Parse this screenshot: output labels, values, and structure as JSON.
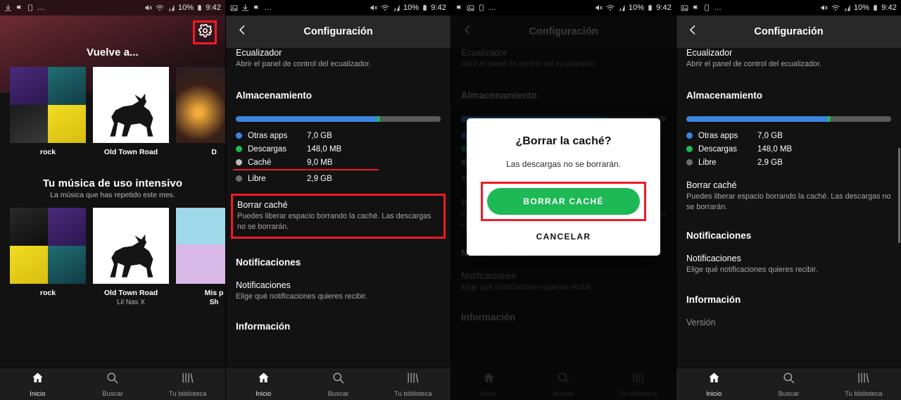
{
  "statusbar": {
    "battery_text": "10%",
    "time": "9:42",
    "overflow": "…",
    "icons": [
      "download-icon",
      "image-icon",
      "flag-icon",
      "sim-card-icon"
    ],
    "right_icons": [
      "mute-icon",
      "wifi-icon",
      "signal-icon",
      "battery-icon"
    ]
  },
  "panel1": {
    "name": "spotify-home",
    "gear_icon": "gear-icon",
    "section1": {
      "title": "Vuelve a...",
      "cards": [
        {
          "label": "rock",
          "sub": ""
        },
        {
          "label": "Old Town Road",
          "sub": ""
        },
        {
          "label": "D",
          "sub": ""
        }
      ]
    },
    "section2": {
      "title": "Tu música de uso intensivo",
      "subtitle": "La música que has repetido este mes.",
      "cards": [
        {
          "label": "rock",
          "sub": ""
        },
        {
          "label": "Old Town Road",
          "sub": "Lil Nas X"
        },
        {
          "label": "Mis p",
          "sub": "Sh"
        }
      ]
    }
  },
  "nav": {
    "items": [
      {
        "label": "Inicio",
        "icon": "home-icon",
        "active": true
      },
      {
        "label": "Buscar",
        "icon": "search-icon",
        "active": false
      },
      {
        "label": "Tu biblioteca",
        "icon": "library-icon",
        "active": false
      }
    ]
  },
  "settings": {
    "title": "Configuración",
    "back_icon": "chevron-left-icon",
    "equalizer": {
      "title": "Ecualizador",
      "desc": "Abrir el panel de control del ecualizador."
    },
    "storage": {
      "heading": "Almacenamiento",
      "bar": [
        {
          "key": "otras",
          "pct": 69.0,
          "color": "#3b86e0"
        },
        {
          "key": "descargas",
          "pct": 1.5,
          "color": "#1db954"
        },
        {
          "key": "libre",
          "pct": 29.5,
          "color": "#5a5a5a"
        }
      ],
      "legend_full": [
        {
          "name": "Otras apps",
          "value": "7,0 GB",
          "color": "#3b86e0"
        },
        {
          "name": "Descargas",
          "value": "148,0 MB",
          "color": "#1db954"
        },
        {
          "name": "Caché",
          "value": "9,0 MB",
          "color": "#bcbcbc"
        },
        {
          "name": "Libre",
          "value": "2,9 GB",
          "color": "#6d6d6d"
        }
      ],
      "legend_cleared": [
        {
          "name": "Otras apps",
          "value": "7,0 GB",
          "color": "#3b86e0"
        },
        {
          "name": "Descargas",
          "value": "148,0 MB",
          "color": "#1db954"
        },
        {
          "name": "Libre",
          "value": "2,9 GB",
          "color": "#6d6d6d"
        }
      ]
    },
    "clear_cache": {
      "title": "Borrar caché",
      "desc": "Puedes liberar espacio borrando la caché. Las descargas no se borrarán."
    },
    "notifications": {
      "heading": "Notificaciones",
      "title": "Notificaciones",
      "desc": "Elige qué notificaciones quieres recibir."
    },
    "information": {
      "heading": "Información",
      "version_label": "Versión"
    }
  },
  "dialog": {
    "title": "¿Borrar la caché?",
    "message": "Las descargas no se borrarán.",
    "confirm_label": "BORRAR CACHÉ",
    "cancel_label": "CANCELAR",
    "confirm_color": "#1db954",
    "highlight_color": "#ef1b24"
  }
}
